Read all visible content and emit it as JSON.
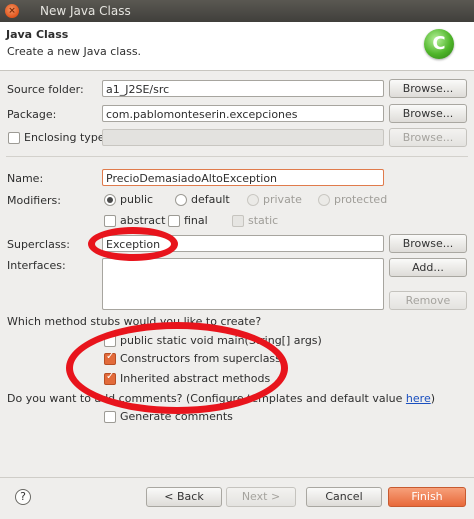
{
  "window": {
    "title": "New Java Class"
  },
  "header": {
    "title": "Java Class",
    "description": "Create a new Java class."
  },
  "form": {
    "source_folder": {
      "label": "Source folder:",
      "value": "a1_J2SE/src",
      "button": "Browse..."
    },
    "package": {
      "label": "Package:",
      "value": "com.pablomonteserin.excepciones",
      "button": "Browse..."
    },
    "enclosing_type": {
      "label": "Enclosing type:",
      "value": "",
      "button": "Browse...",
      "checked": false
    },
    "name": {
      "label": "Name:",
      "value": "PrecioDemasiadoAltoException"
    },
    "modifiers": {
      "label": "Modifiers:",
      "public": "public",
      "default": "default",
      "private": "private",
      "protected": "protected",
      "abstract": "abstract",
      "final": "final",
      "static": "static",
      "selected": "public"
    },
    "superclass": {
      "label": "Superclass:",
      "value": "Exception",
      "button": "Browse..."
    },
    "interfaces": {
      "label": "Interfaces:",
      "add_button": "Add...",
      "remove_button": "Remove"
    },
    "stubs": {
      "question": "Which method stubs would you like to create?",
      "main": "public static void main(String[] args)",
      "constructors": "Constructors from superclass",
      "inherited": "Inherited abstract methods",
      "main_checked": false,
      "constructors_checked": true,
      "inherited_checked": true
    },
    "comments": {
      "question_prefix": "Do you want to add comments? (Configure templates and default value ",
      "link": "here",
      "question_suffix": ")",
      "generate": "Generate comments",
      "checked": false
    }
  },
  "footer": {
    "back": "< Back",
    "next": "Next >",
    "cancel": "Cancel",
    "finish": "Finish"
  },
  "colors": {
    "accent": "#e8693a",
    "annotation": "#e8141c"
  }
}
